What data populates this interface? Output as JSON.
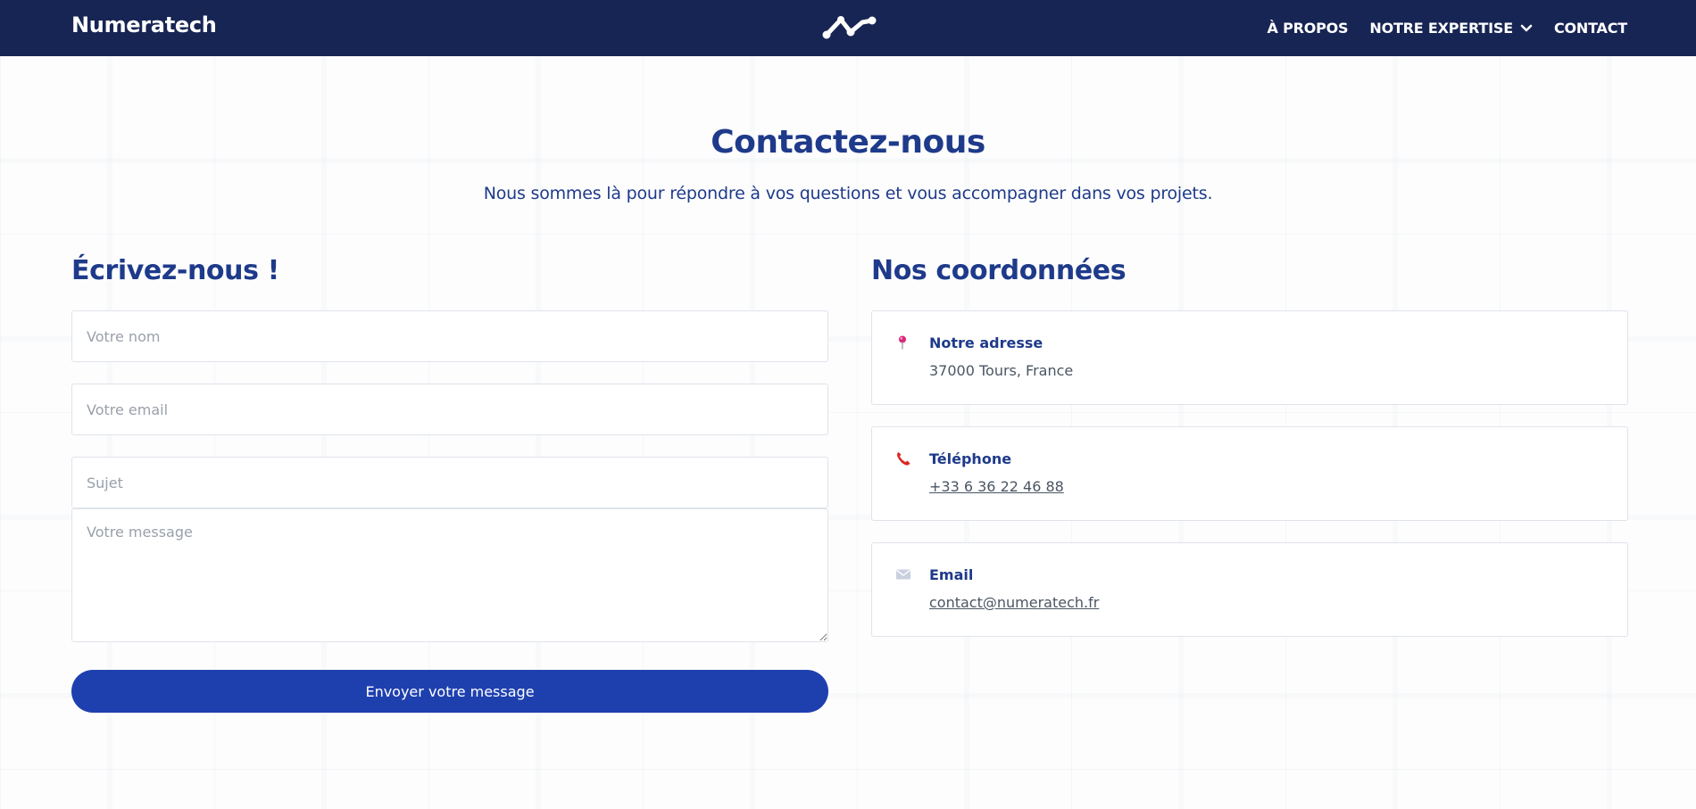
{
  "navbar": {
    "brand": "Numeratech",
    "logo_icon": "network-nodes-logo",
    "links": [
      {
        "label": "À PROPOS"
      },
      {
        "label": "NOTRE EXPERTISE",
        "has_dropdown": true
      },
      {
        "label": "CONTACT"
      }
    ]
  },
  "header": {
    "title": "Contactez-nous",
    "subtitle": "Nous sommes là pour répondre à vos questions et vous accompagner dans vos projets."
  },
  "form": {
    "heading": "Écrivez-nous !",
    "name_placeholder": "Votre nom",
    "email_placeholder": "Votre email",
    "subject_placeholder": "Sujet",
    "message_placeholder": "Votre message",
    "submit_label": "Envoyer votre message"
  },
  "contact_info": {
    "heading": "Nos coordonnées",
    "cards": [
      {
        "icon": "map-pin-icon",
        "label": "Notre adresse",
        "value": "37000 Tours, France"
      },
      {
        "icon": "phone-icon",
        "label": "Téléphone",
        "value": "+33 6 36 22 46 88"
      },
      {
        "icon": "envelope-icon",
        "label": "Email",
        "value": "contact@numeratech.fr"
      }
    ]
  },
  "colors": {
    "navbar_bg": "#172554",
    "heading": "#1e3a8a",
    "button_bg": "#1e40af",
    "pin": "#db2777",
    "phone": "#dc2626"
  }
}
